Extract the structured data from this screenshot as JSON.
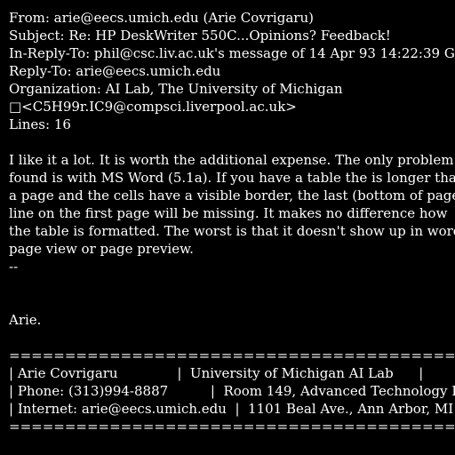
{
  "header": {
    "from": "From: arie@eecs.umich.edu (Arie Covrigaru)",
    "subject": "Subject: Re: HP DeskWriter 550C...Opinions? Feedback!",
    "in_reply_to": "In-Reply-To: phil@csc.liv.ac.uk's message of 14 Apr 93 14:22:39 GMT",
    "reply_to": "Reply-To: arie@eecs.umich.edu",
    "organization": "Organization: AI Lab, The University of Michigan",
    "message_ref": "□<C5H99r.IC9@compsci.liverpool.ac.uk>",
    "lines": "Lines: 16"
  },
  "body": {
    "para": [
      "I like it a lot. It is worth the additional expense. The only problem I",
      "found is with MS Word (5.1a). If you have a table the is longer than",
      "a page and the cells have a visible border, the last (bottom of page)",
      "line on the first page will be missing. It makes no difference how",
      "the table is formatted. The worst is that it doesn't show up in word's",
      "page view or page preview."
    ],
    "sig_dash": "--",
    "signoff": "Arie."
  },
  "signature": {
    "rule": "=================================================================",
    "rows": [
      "| Arie Covrigaru              |  University of Michigan AI Lab      |",
      "| Phone: (313)994-8887          |  Room 149, Advanced Technology Bldg. |",
      "| Internet: arie@eecs.umich.edu  |  1101 Beal Ave., Ann Arbor, MI 48109 |"
    ]
  }
}
